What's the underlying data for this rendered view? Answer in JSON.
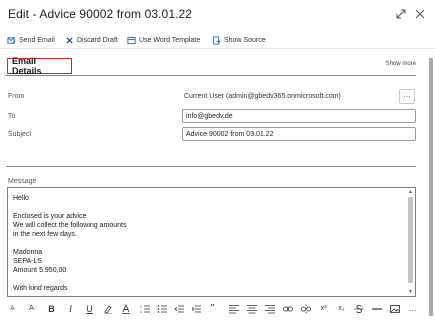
{
  "window": {
    "title": "Edit - Advice 90002 from 03.01.22",
    "expand_icon": "expand-icon",
    "close_icon": "close-icon"
  },
  "toolbar": {
    "send_email": "Send Email",
    "discard_draft": "Discard Draft",
    "use_word_template": "Use Word Template",
    "show_source": "Show Source"
  },
  "section": {
    "title": "Email Details",
    "show_more": "Show more"
  },
  "fields": {
    "from_label": "From",
    "from_value": "Current User (admin@gbedv365.onmicrosoft.com)",
    "more_button": "···",
    "to_label": "To",
    "to_value": "info@gbedv.de",
    "subject_label": "Subject",
    "subject_value": "Advice 90002 from 03.01.22",
    "message_label": "Message"
  },
  "message": {
    "lines": [
      "Hello",
      "",
      "Enclosed is your advice",
      "We will collect the following amounts",
      "in the next few days.",
      "",
      "Madonna",
      "SEPA-LS",
      "Amount 5.950,00",
      "",
      "With kind regards"
    ]
  },
  "format_toolbar": {
    "icons": [
      "font-size-decrease-icon",
      "font-size-increase-icon",
      "bold-icon",
      "italic-icon",
      "underline-icon",
      "highlight-icon",
      "font-color-icon",
      "numbered-list-icon",
      "bulleted-list-icon",
      "outdent-icon",
      "indent-icon",
      "quote-icon",
      "align-left-icon",
      "align-center-icon",
      "align-right-icon",
      "link-icon",
      "unlink-icon",
      "superscript-icon",
      "subscript-icon",
      "strikethrough-icon",
      "horizontal-rule-icon",
      "image-icon",
      "more-icon"
    ],
    "glyphs": {
      "bold": "B",
      "italic": "I",
      "underline": "U",
      "quote": "”",
      "superscript": "x²",
      "subscript": "x₂",
      "more": "…"
    }
  },
  "colors": {
    "accent": "#1f6fb5",
    "highlight_border": "#d9262a"
  }
}
